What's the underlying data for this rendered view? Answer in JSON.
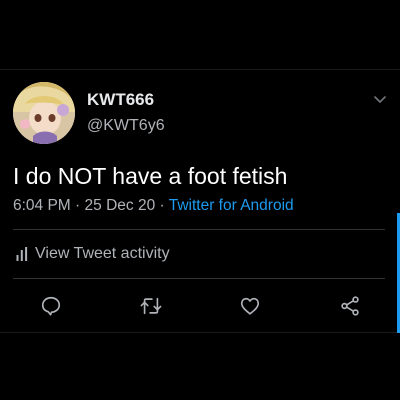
{
  "tweet": {
    "display_name": "KWT666",
    "handle": "@KWT6y6",
    "text": "I do NOT have a foot fetish",
    "time": "6:04 PM",
    "separator": "·",
    "date": "25 Dec 20",
    "source": "Twitter for Android"
  },
  "activity": {
    "label": "View Tweet activity",
    "icon": "bar-chart-icon"
  },
  "actions": [
    {
      "name": "reply",
      "icon": "speech-bubble-icon"
    },
    {
      "name": "retweet",
      "icon": "retweet-arrows-icon"
    },
    {
      "name": "like",
      "icon": "heart-icon"
    },
    {
      "name": "share",
      "icon": "share-nodes-icon"
    }
  ],
  "colors": {
    "background": "#000000",
    "text_primary": "#ffffff",
    "text_secondary": "#b0b3b8",
    "accent": "#1d9bf0",
    "divider": "#2f3336"
  }
}
